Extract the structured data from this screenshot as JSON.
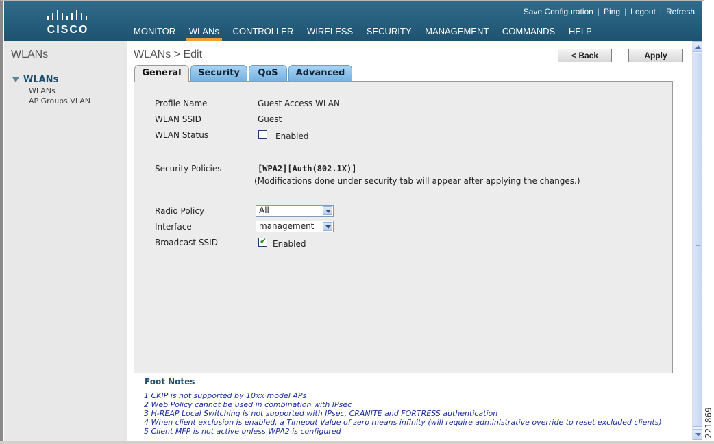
{
  "header": {
    "logo_text": "CISCO",
    "links": [
      "Save Configuration",
      "Ping",
      "Logout",
      "Refresh"
    ],
    "nav": [
      "MONITOR",
      "WLANs",
      "CONTROLLER",
      "WIRELESS",
      "SECURITY",
      "MANAGEMENT",
      "COMMANDS",
      "HELP"
    ],
    "active_nav": "WLANs"
  },
  "sidebar": {
    "title": "WLANs",
    "tree_head": "WLANs",
    "items": [
      "WLANs",
      "AP Groups VLAN"
    ]
  },
  "main": {
    "title": "WLANs > Edit",
    "back_label": "< Back",
    "apply_label": "Apply",
    "tabs": [
      "General",
      "Security",
      "QoS",
      "Advanced"
    ],
    "active_tab": "General"
  },
  "form": {
    "profile_name_label": "Profile Name",
    "profile_name_value": "Guest Access WLAN",
    "ssid_label": "WLAN SSID",
    "ssid_value": "Guest",
    "status_label": "WLAN Status",
    "status_checkbox_label": "Enabled",
    "status_checked": false,
    "security_label": "Security Policies",
    "security_value": "[WPA2][Auth(802.1X)]",
    "security_note": "(Modifications done under security tab will appear after applying the changes.)",
    "radio_policy_label": "Radio Policy",
    "radio_policy_value": "All",
    "interface_label": "Interface",
    "interface_value": "management",
    "broadcast_label": "Broadcast SSID",
    "broadcast_checkbox_label": "Enabled",
    "broadcast_checked": true
  },
  "footnotes": {
    "title": "Foot Notes",
    "items": [
      "1 CKIP is not supported by 10xx model APs",
      "2 Web Policy cannot be used in combination with IPsec",
      "3 H-REAP Local Switching is not supported with IPsec, CRANITE and FORTRESS authentication",
      "4 When client exclusion is enabled, a Timeout Value of zero means infinity (will require administrative override to reset excluded clients)",
      "5 Client MFP is not active unless WPA2 is configured"
    ]
  },
  "figure_number": "221869",
  "colors": {
    "header_bg": "#235a78",
    "active_nav_underline": "#f0a030",
    "tab_blue": "#74b1e0",
    "panel_bg": "#ececec",
    "footnote_text": "#1a2f9a"
  }
}
